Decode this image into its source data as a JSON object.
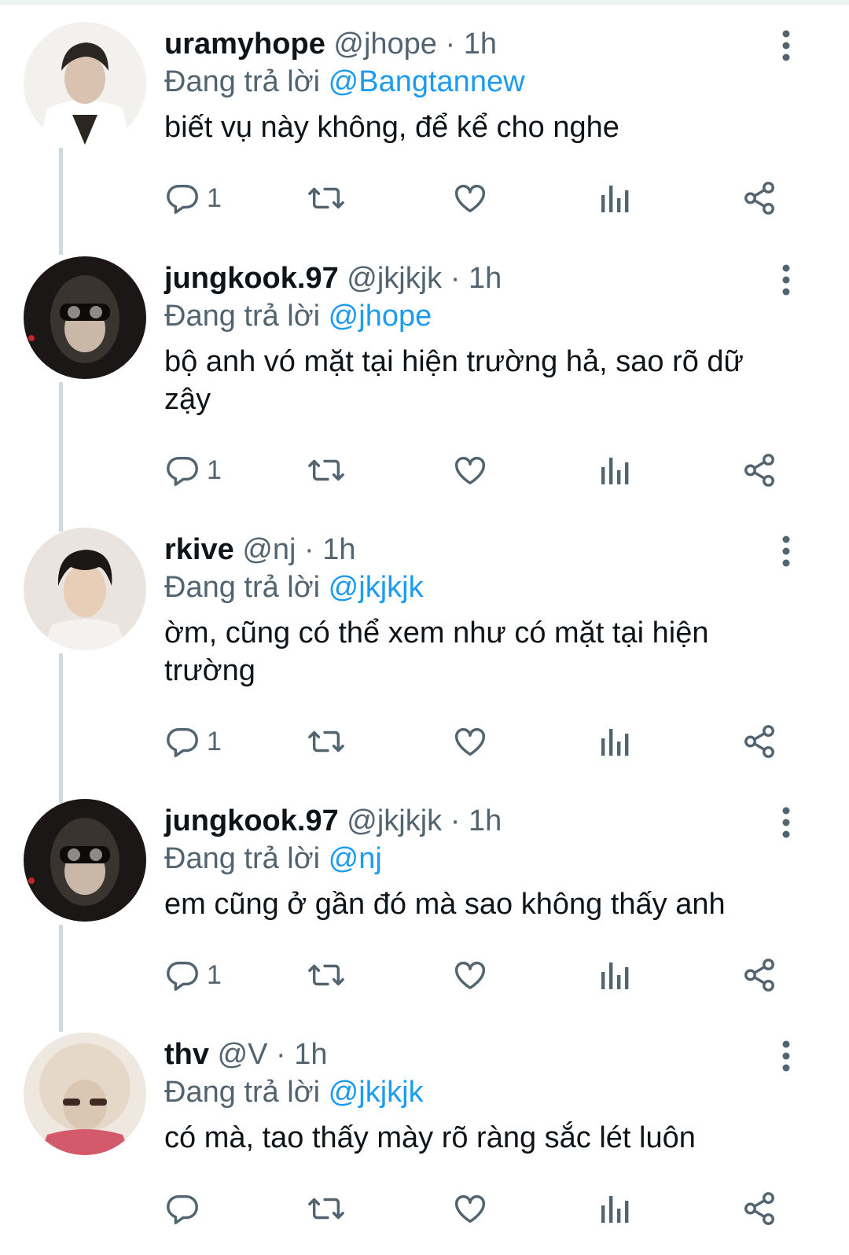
{
  "reply_prefix": "Đang trả lời ",
  "tweets": [
    {
      "name": "uramyhope",
      "handle": "@jhope",
      "separator": "·",
      "time": "1h",
      "reply_to": "@Bangtannew",
      "text": "biết vụ này không, để kể cho nghe",
      "reply_count": "1",
      "avatar_colors": [
        "#f3f1ee",
        "#d9d3cb",
        "#2b2622"
      ]
    },
    {
      "name": "jungkook.97",
      "handle": "@jkjkjk",
      "separator": "·",
      "time": "1h",
      "reply_to": "@jhope",
      "text": "bộ anh vó mặt tại hiện trường hả, sao rõ dữ zậy",
      "reply_count": "1",
      "avatar_colors": [
        "#1a1716",
        "#3a3431",
        "#c9b8a8"
      ]
    },
    {
      "name": "rkive",
      "handle": "@nj",
      "separator": "·",
      "time": "1h",
      "reply_to": "@jkjkjk",
      "text": "ờm, cũng có thể xem như có mặt tại hiện trường",
      "reply_count": "1",
      "avatar_colors": [
        "#e9e4df",
        "#1b1715",
        "#e8cdb7"
      ]
    },
    {
      "name": "jungkook.97",
      "handle": "@jkjkjk",
      "separator": "·",
      "time": "1h",
      "reply_to": "@nj",
      "text": "em cũng ở gần đó mà sao không thấy anh",
      "reply_count": "1",
      "avatar_colors": [
        "#1a1716",
        "#3a3431",
        "#c9b8a8"
      ]
    },
    {
      "name": "thv",
      "handle": "@V",
      "separator": "·",
      "time": "1h",
      "reply_to": "@jkjkjk",
      "text": "có mà, tao thấy mày rõ ràng sắc lét luôn",
      "reply_count": "",
      "avatar_colors": [
        "#efe8e1",
        "#d9c6b3",
        "#d35a6a"
      ]
    }
  ],
  "icons": {
    "more": "more-vertical-icon",
    "reply": "reply-icon",
    "retweet": "retweet-icon",
    "like": "heart-icon",
    "views": "views-icon",
    "share": "share-icon"
  },
  "colors": {
    "text": "#0f1419",
    "muted": "#536471",
    "accent": "#1d9bf0",
    "thread": "#cfd9de"
  }
}
